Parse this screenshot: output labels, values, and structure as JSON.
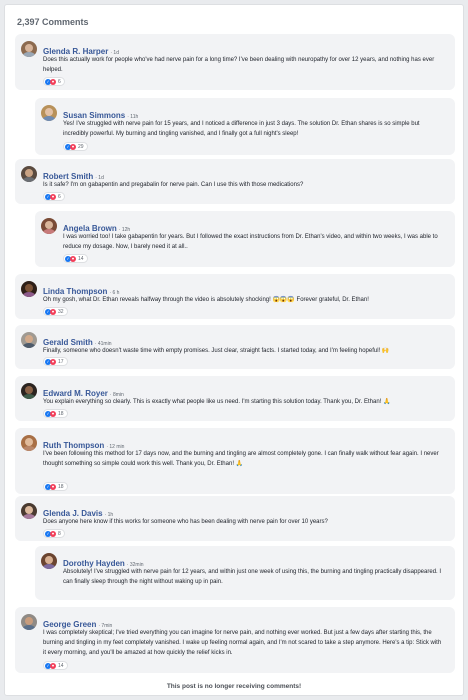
{
  "header": {
    "comment_count": "2,397 Comments"
  },
  "comments": [
    {
      "name": "Glenda R. Harper",
      "time": "· 1d",
      "text": "Does this actually work for people who've had nerve pain for a long time? I've been dealing with neuropathy for over 12 years, and nothing has ever helped.",
      "reactions": "6",
      "skin": "#d7b49a",
      "hair": "#8c6a4f",
      "shirt": "#9aa7b5"
    },
    {
      "name": "Susan Simmons",
      "time": "· 11h",
      "text": "Yes! I've struggled with nerve pain for 15 years, and I noticed a difference in just 3 days. The solution Dr. Ethan shares is so simple but incredibly powerful. My burning and tingling vanished, and I finally got a full night's sleep!",
      "reactions": "29",
      "skin": "#e3c1a6",
      "hair": "#b8915a",
      "shirt": "#6f8bb3"
    },
    {
      "name": "Robert Smith",
      "time": "· 1d",
      "text": "Is it safe? I'm on gabapentin and pregabalin for nerve pain. Can I use this with those medications?",
      "reactions": "6",
      "skin": "#c9a283",
      "hair": "#5a4a3f",
      "shirt": "#6b6e73"
    },
    {
      "name": "Angela Brown",
      "time": "· 12h",
      "text": "I was worried too! I take gabapentin for years. But I followed the exact instructions from Dr. Ethan's video, and within two weeks, I was able to reduce my dosage. Now, I barely need it at all..",
      "reactions": "14",
      "skin": "#d9b59a",
      "hair": "#7a4b36",
      "shirt": "#c77a7a"
    },
    {
      "name": "Linda Thompson",
      "time": "· 6 h",
      "text": "Oh my gosh, what Dr. Ethan reveals halfway through the video is absolutely shocking! 😱😱😱 Forever grateful, Dr. Ethan!",
      "reactions": "32",
      "skin": "#7a5236",
      "hair": "#2e1f17",
      "shirt": "#8d5a8a"
    },
    {
      "name": "Gerald Smith",
      "time": "· 41min",
      "text": "Finally, someone who doesn't waste time with empty promises. Just clear, straight facts. I started today, and I'm feeling hopeful! 🙌",
      "reactions": "17",
      "skin": "#d2a98a",
      "hair": "#a09a92",
      "shirt": "#4e5b6b"
    },
    {
      "name": "Edward M. Royer",
      "time": "· 8min",
      "text": "You explain everything so clearly. This is exactly what people like us need. I'm starting this solution today. Thank you, Dr. Ethan! 🙏",
      "reactions": "18",
      "skin": "#8a6247",
      "hair": "#2b2420",
      "shirt": "#3f5c4a"
    },
    {
      "name": "Ruth Thompson",
      "time": "· 12 min",
      "text": "I've been following this method for 17 days now, and the burning and tingling are almost completely gone. I can finally walk without fear again. I never thought something so simple could work this well. Thank you, Dr. Ethan! 🙏",
      "reactions": "18",
      "skin": "#e0bb9c",
      "hair": "#a86f45",
      "shirt": "#b8876b"
    },
    {
      "name": "Glenda J. Davis",
      "time": "· 1h",
      "text": "Does anyone here know if this works for someone who has been dealing with nerve pain for over 10 years?",
      "reactions": "8",
      "skin": "#dcb99d",
      "hair": "#4a3a30",
      "shirt": "#a67a9b"
    },
    {
      "name": "Dorothy Hayden",
      "time": "· 32min",
      "text": "Absolutely! I've struggled with nerve pain for 12 years, and within just one week of using this, the burning and tingling practically disappeared. I can finally sleep through the night without waking up in pain.",
      "reactions": "",
      "skin": "#d8b092",
      "hair": "#6b4430",
      "shirt": "#7d6a9e"
    },
    {
      "name": "George Green",
      "time": "· 7min",
      "text": "I was completely skeptical; I've tried everything you can imagine for nerve pain, and nothing ever worked. But just a few days after starting this, the burning and tingling in my feet completely vanished. I wake up feeling normal again, and I'm not scared to take a step anymore. Here's a tip: Stick with it every morning, and you'll be amazed at how quickly the relief kicks in.",
      "reactions": "14",
      "skin": "#c79c7d",
      "hair": "#8f8a85",
      "shirt": "#5a6f8a"
    }
  ],
  "footer": {
    "text": "This post is no longer receiving comments!"
  }
}
